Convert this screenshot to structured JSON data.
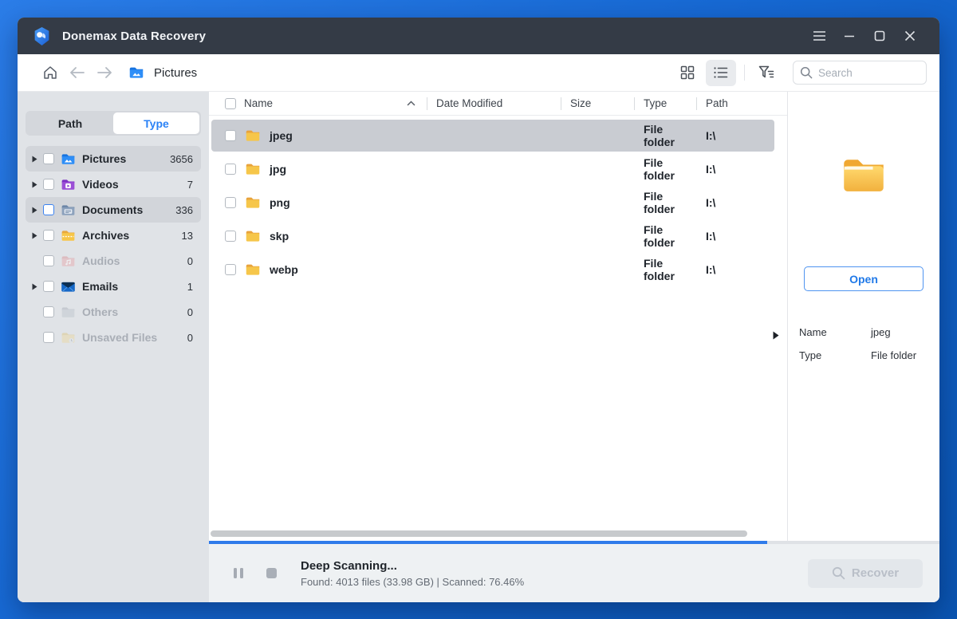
{
  "colors": {
    "desktop_blue": "#1668d2",
    "titlebar_bg": "#343b46",
    "accent_blue": "#2b82f6",
    "progress_blue": "#2f7bea",
    "selection_gray": "#c9ccd2",
    "folder_yellow": "#f5bd4a"
  },
  "title_bar": {
    "app_title": "Donemax Data Recovery"
  },
  "toolbar": {
    "breadcrumb": "Pictures",
    "search": {
      "placeholder": "Search"
    }
  },
  "sidebar": {
    "tabs": [
      {
        "label": "Path",
        "active": false
      },
      {
        "label": "Type",
        "active": true
      }
    ],
    "items": [
      {
        "label": "Pictures",
        "count": "3656",
        "icon": "pictures-folder-icon",
        "enabled": true,
        "expandable": true,
        "highlighted": true,
        "checkbox_accent": false
      },
      {
        "label": "Videos",
        "count": "7",
        "icon": "videos-folder-icon",
        "enabled": true,
        "expandable": true,
        "highlighted": false,
        "checkbox_accent": false
      },
      {
        "label": "Documents",
        "count": "336",
        "icon": "documents-folder-icon",
        "enabled": true,
        "expandable": true,
        "highlighted": true,
        "checkbox_accent": true
      },
      {
        "label": "Archives",
        "count": "13",
        "icon": "archives-folder-icon",
        "enabled": true,
        "expandable": true,
        "highlighted": false,
        "checkbox_accent": false
      },
      {
        "label": "Audios",
        "count": "0",
        "icon": "audios-folder-icon",
        "enabled": false,
        "expandable": false,
        "highlighted": false,
        "checkbox_accent": false
      },
      {
        "label": "Emails",
        "count": "1",
        "icon": "emails-folder-icon",
        "enabled": true,
        "expandable": true,
        "highlighted": false,
        "checkbox_accent": false
      },
      {
        "label": "Others",
        "count": "0",
        "icon": "others-folder-icon",
        "enabled": false,
        "expandable": false,
        "highlighted": false,
        "checkbox_accent": false
      },
      {
        "label": "Unsaved Files",
        "count": "0",
        "icon": "unsaved-files-folder-icon",
        "enabled": false,
        "expandable": false,
        "highlighted": false,
        "checkbox_accent": false
      }
    ]
  },
  "file_list": {
    "columns": [
      {
        "label": "Name",
        "sort": "asc"
      },
      {
        "label": "Date Modified",
        "sort": ""
      },
      {
        "label": "Size",
        "sort": ""
      },
      {
        "label": "Type",
        "sort": ""
      },
      {
        "label": "Path",
        "sort": ""
      }
    ],
    "rows": [
      {
        "name": "jpeg",
        "date_modified": "",
        "size": "",
        "type": "File folder",
        "path": "I:\\",
        "selected": true
      },
      {
        "name": "jpg",
        "date_modified": "",
        "size": "",
        "type": "File folder",
        "path": "I:\\",
        "selected": false
      },
      {
        "name": "png",
        "date_modified": "",
        "size": "",
        "type": "File folder",
        "path": "I:\\",
        "selected": false
      },
      {
        "name": "skp",
        "date_modified": "",
        "size": "",
        "type": "File folder",
        "path": "I:\\",
        "selected": false
      },
      {
        "name": "webp",
        "date_modified": "",
        "size": "",
        "type": "File folder",
        "path": "I:\\",
        "selected": false
      }
    ]
  },
  "preview_panel": {
    "open_button": "Open",
    "fields": [
      {
        "label": "Name",
        "value": "jpeg"
      },
      {
        "label": "Type",
        "value": "File folder"
      }
    ]
  },
  "status_bar": {
    "title": "Deep Scanning...",
    "detail": "Found: 4013 files (33.98 GB) | Scanned: 76.46%",
    "recover_label": "Recover",
    "progress_percent": 76.46
  }
}
